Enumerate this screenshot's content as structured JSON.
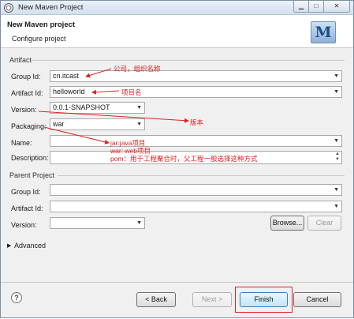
{
  "window": {
    "title": "New Maven Project"
  },
  "header": {
    "title": "New Maven project",
    "subtitle": "Configure project",
    "logo": "M"
  },
  "artifact": {
    "section": "Artifact",
    "group_label": "Group Id:",
    "group_value": "cn.itcast",
    "artifact_label": "Artifact Id:",
    "artifact_value": "helloworld",
    "version_label": "Version:",
    "version_value": "0.0.1-SNAPSHOT",
    "packaging_label": "Packaging:",
    "packaging_value": "war",
    "name_label": "Name:",
    "name_value": "",
    "description_label": "Description:",
    "description_value": ""
  },
  "parent": {
    "section": "Parent Project",
    "group_label": "Group Id:",
    "group_value": "",
    "artifact_label": "Artifact Id:",
    "artifact_value": "",
    "version_label": "Version:",
    "version_value": "",
    "browse_label": "Browse...",
    "clear_label": "Clear"
  },
  "advanced": {
    "label": "Advanced"
  },
  "buttons": {
    "help": "?",
    "back": "< Back",
    "next": "Next >",
    "finish": "Finish",
    "cancel": "Cancel"
  },
  "annotations": {
    "group": "公司，组织名称",
    "artifact": "项目名",
    "version": "版本",
    "jar": "jar:java项目",
    "war": "war: web项目",
    "pom": "pom：用于工程聚合时，父工程一般选择这种方式"
  },
  "colors": {
    "annotation": "#e02020",
    "titlebar": "#d3e0ef",
    "primary_button": "#bee6fd"
  }
}
